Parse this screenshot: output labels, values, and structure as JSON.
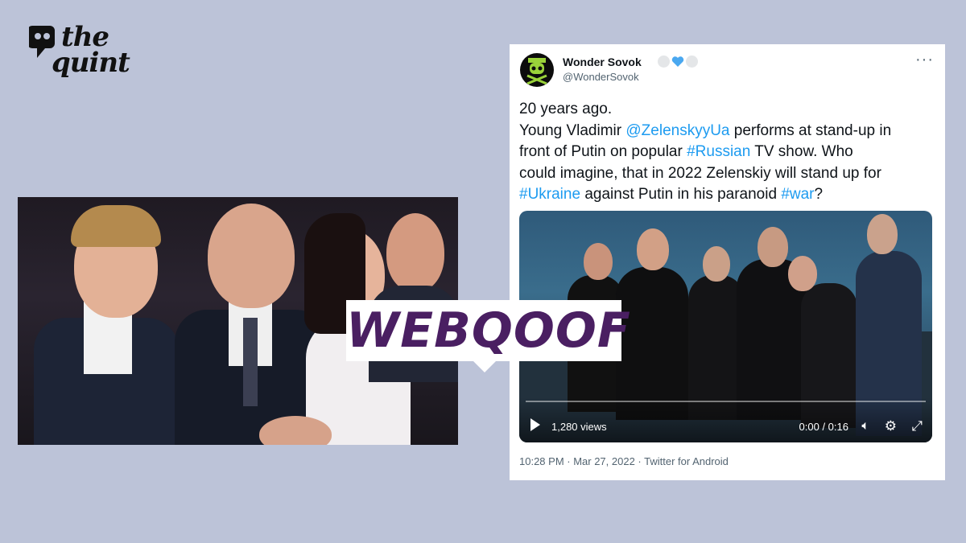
{
  "logo": {
    "line1": "the",
    "line2": "quint",
    "icon": "quote-mark-icon"
  },
  "tweet": {
    "display_name": "Wonder Sovok",
    "handle": "@WonderSovok",
    "badge_colors": [
      "#e4e6e8",
      "#4aa8f0",
      "#e4e6e8"
    ],
    "more_label": "···",
    "text": {
      "line1": "20 years ago.",
      "line2_a": "Young Vladimir ",
      "line2_mention": "@ZelenskyyUa",
      "line2_b": " performs at stand-up in",
      "line3_a": "front of Putin on popular ",
      "line3_tag": "#Russian",
      "line3_b": " TV show. Who",
      "line4": "could imagine, that in 2022 Zelenskiy will stand up for",
      "line5_tag1": "#Ukraine",
      "line5_a": " against Putin in his paranoid ",
      "line5_tag2": "#war",
      "line5_b": "?"
    },
    "video": {
      "views": "1,280 views",
      "time": "0:00 / 0:16",
      "progress": 0
    },
    "meta": "10:28 PM · Mar 27, 2022 · Twitter for Android",
    "link_color": "#1d9bf0"
  },
  "stamp": {
    "label": "WEBQOOF",
    "color": "#4a1f62"
  }
}
